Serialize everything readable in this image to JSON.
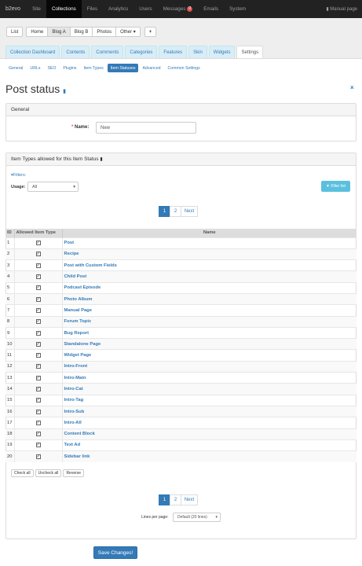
{
  "topbar": {
    "brand": "b2evo",
    "nav": [
      "Site",
      "Collections",
      "Files",
      "Analytics",
      "Users",
      "Messages",
      "Emails",
      "System"
    ],
    "messages_badge": "0",
    "manual": "Manual page"
  },
  "collections": {
    "buttons": [
      "List",
      "Home",
      "Blog A",
      "Blog B",
      "Photos",
      "Other ▾",
      "+"
    ]
  },
  "main_tabs": [
    "Collection Dashboard",
    "Contents",
    "Comments",
    "Categories",
    "Features",
    "Skin",
    "Widgets",
    "Settings"
  ],
  "sub_tabs": [
    "General",
    "URLs",
    "SEO",
    "Plugins",
    "Item Types",
    "Item Statuses",
    "Advanced",
    "Common Settings"
  ],
  "page_title": "Post status",
  "general_panel": {
    "title": "General",
    "name_label": "Name:",
    "name_value": "New"
  },
  "types_panel": {
    "title": "Item Types allowed for this Item Status",
    "filters_label": "Filters:",
    "usage_label": "Usage:",
    "usage_value": "All",
    "filter_button": "Filter list",
    "pagination": [
      "1",
      "2",
      "Next"
    ],
    "headers": {
      "id": "ID",
      "allowed": "Allowed Item Type",
      "name": "Name"
    },
    "rows": [
      {
        "id": "1",
        "name": "Post"
      },
      {
        "id": "2",
        "name": "Recipe"
      },
      {
        "id": "3",
        "name": "Post with Custom Fields"
      },
      {
        "id": "4",
        "name": "Child Post"
      },
      {
        "id": "5",
        "name": "Podcast Episode"
      },
      {
        "id": "6",
        "name": "Photo Album"
      },
      {
        "id": "7",
        "name": "Manual Page"
      },
      {
        "id": "8",
        "name": "Forum Topic"
      },
      {
        "id": "9",
        "name": "Bug Report"
      },
      {
        "id": "10",
        "name": "Standalone Page"
      },
      {
        "id": "11",
        "name": "Widget Page"
      },
      {
        "id": "12",
        "name": "Intro-Front"
      },
      {
        "id": "13",
        "name": "Intro-Main"
      },
      {
        "id": "14",
        "name": "Intro-Cat"
      },
      {
        "id": "15",
        "name": "Intro-Tag"
      },
      {
        "id": "16",
        "name": "Intro-Sub"
      },
      {
        "id": "17",
        "name": "Intro-All"
      },
      {
        "id": "18",
        "name": "Content Block"
      },
      {
        "id": "19",
        "name": "Text Ad"
      },
      {
        "id": "20",
        "name": "Sidebar link"
      }
    ],
    "check_all": "Check all",
    "uncheck_all": "Uncheck all",
    "reverse": "Reverse",
    "lines_label": "Lines per page:",
    "lines_value": "Default (20 lines)"
  },
  "save_button": "Save Changes!",
  "colors": {
    "primary": "#337ab7",
    "topbar": "#222222",
    "link": "#337ab7"
  }
}
